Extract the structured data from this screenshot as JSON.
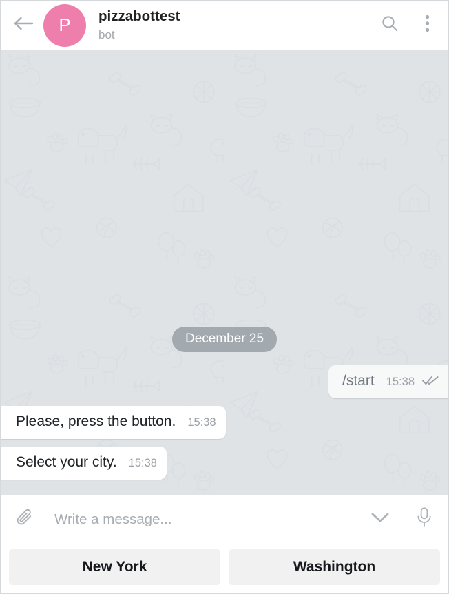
{
  "header": {
    "back_icon": "arrow-left-icon",
    "avatar": {
      "letter": "P",
      "color": "#ee7fac"
    },
    "title": "pizzabottest",
    "status": "bot",
    "search_icon": "search-icon",
    "menu_icon": "more-vertical-icon"
  },
  "chat": {
    "background_color": "#dfe3e6",
    "date_divider": "December 25",
    "messages": [
      {
        "direction": "out",
        "text": "/start",
        "is_command": true,
        "time": "15:38",
        "status_icon": "double-check-icon",
        "tail": true
      },
      {
        "direction": "in",
        "text": "Please, press the button.",
        "is_command": false,
        "time": "15:38",
        "tail": false
      },
      {
        "direction": "in",
        "text": "Select your city.",
        "is_command": false,
        "time": "15:38",
        "tail": true
      }
    ]
  },
  "composer": {
    "attach_icon": "paperclip-icon",
    "input_value": "",
    "placeholder": "Write a message...",
    "emoji_icon": "chevron-down-icon",
    "voice_icon": "microphone-icon"
  },
  "keyboard": {
    "buttons": [
      {
        "label": "New York"
      },
      {
        "label": "Washington"
      }
    ]
  }
}
